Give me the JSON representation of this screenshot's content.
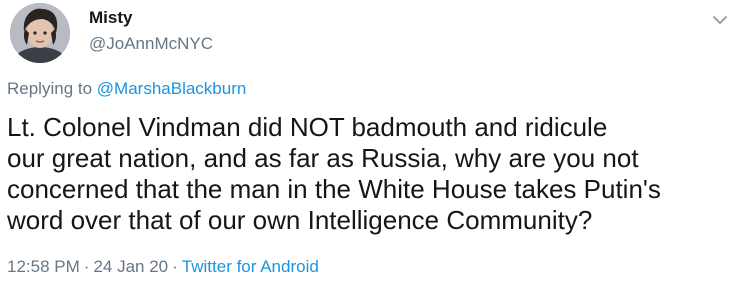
{
  "author": {
    "display_name": "Misty",
    "handle": "@JoAnnMcNYC",
    "avatar_icon": "child-photo-avatar"
  },
  "menu": {
    "icon": "chevron-down-icon"
  },
  "reply": {
    "prefix": "Replying to",
    "mention": "@MarshaBlackburn"
  },
  "tweet": {
    "lines": [
      "Lt. Colonel Vindman did NOT badmouth and ridicule",
      "our great nation, and as far as Russia, why are you not",
      "concerned that the man in the White House takes Putin's",
      "word over that of our own Intelligence Community?"
    ]
  },
  "meta": {
    "time": "12:58 PM",
    "separator": "·",
    "date": "24 Jan 20",
    "source": "Twitter for Android"
  },
  "colors": {
    "text_primary": "#14171a",
    "text_secondary": "#657786",
    "link": "#1b95e0"
  }
}
